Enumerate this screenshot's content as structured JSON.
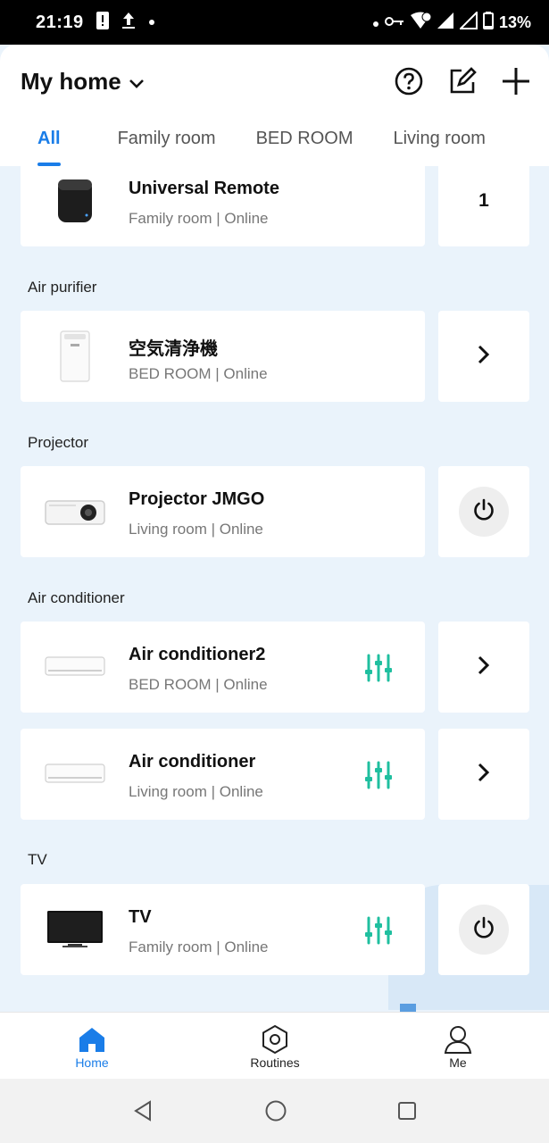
{
  "status_bar": {
    "time": "21:19",
    "battery": "13%"
  },
  "header": {
    "home_title": "My home",
    "tabs": [
      {
        "label": "All",
        "active": true
      },
      {
        "label": "Family room",
        "active": false
      },
      {
        "label": "BED ROOM",
        "active": false
      },
      {
        "label": "Living room",
        "active": false
      }
    ]
  },
  "sections": {
    "air_purifier": "Air purifier",
    "projector": "Projector",
    "air_conditioner": "Air conditioner",
    "tv": "TV"
  },
  "devices": {
    "universal_remote": {
      "name": "Universal Remote",
      "sub": "Family room | Online",
      "count": "1"
    },
    "air_purifier": {
      "name": "空気清浄機",
      "sub": "BED ROOM | Online"
    },
    "projector": {
      "name": "Projector JMGO",
      "sub": "Living room | Online"
    },
    "ac2": {
      "name": "Air conditioner2",
      "sub": "BED ROOM | Online"
    },
    "ac": {
      "name": "Air conditioner",
      "sub": "Living room | Online"
    },
    "tv": {
      "name": "TV",
      "sub": "Family room | Online"
    }
  },
  "bottom_nav": {
    "home": "Home",
    "routines": "Routines",
    "me": "Me"
  },
  "colors": {
    "accent": "#1a7de8",
    "control_teal": "#1fbf9f",
    "background": "#eaf3fb"
  }
}
